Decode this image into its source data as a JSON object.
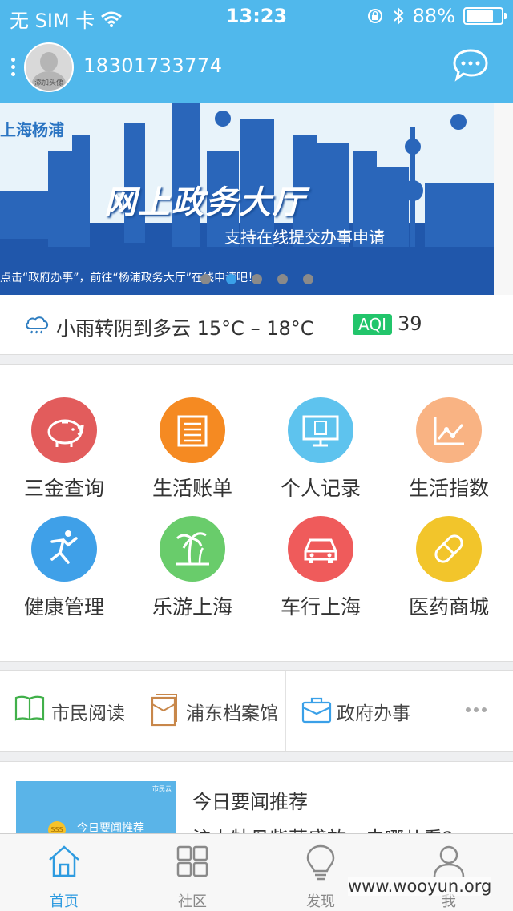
{
  "status_bar": {
    "carrier": "无 SIM 卡",
    "time": "13:23",
    "battery": "88%",
    "battery_level": 0.88
  },
  "header": {
    "avatar_caption": "添加头像",
    "phone": "18301733774",
    "icons": [
      "menu-dots-icon",
      "chat-bubble-icon"
    ]
  },
  "banner": {
    "tag": "上海杨浦",
    "title": "网上政务大厅",
    "subtitle": "支持在线提交办事申请",
    "footer": "点击“政府办事”，前往“杨浦政务大厅”在线申请吧！",
    "slide_count": 5,
    "active_slide": 2
  },
  "weather": {
    "icon": "cloud-rain-icon",
    "description": "小雨转阴到多云",
    "temp_low": "15°C",
    "dash": "–",
    "temp_high": "18°C",
    "aqi_label": "AQI",
    "aqi_value": "39"
  },
  "services": [
    {
      "label": "三金查询",
      "icon": "piggy-bank-icon",
      "color": "#e25c5c"
    },
    {
      "label": "生活账单",
      "icon": "bill-icon",
      "color": "#f58a22"
    },
    {
      "label": "个人记录",
      "icon": "monitor-record-icon",
      "color": "#5ec3ee"
    },
    {
      "label": "生活指数",
      "icon": "line-chart-icon",
      "color": "#f9b383"
    },
    {
      "label": "健康管理",
      "icon": "running-person-icon",
      "color": "#3fa0e8"
    },
    {
      "label": "乐游上海",
      "icon": "palm-tree-icon",
      "color": "#69cc6b"
    },
    {
      "label": "车行上海",
      "icon": "car-icon",
      "color": "#ef5b5b"
    },
    {
      "label": "医药商城",
      "icon": "pill-icon",
      "color": "#f2c52b"
    }
  ],
  "quick_links": [
    {
      "label": "市民阅读",
      "icon": "book-icon",
      "color": "#41b04a"
    },
    {
      "label": "浦东档案馆",
      "icon": "archive-icon",
      "color": "#c8874a"
    },
    {
      "label": "政府办事",
      "icon": "briefcase-icon",
      "color": "#3aa0e8"
    },
    {
      "label": "",
      "icon": "more-icon",
      "color": "#aaaaaa"
    }
  ],
  "news": {
    "title": "今日要闻推荐",
    "subtitle": "沪上牡丹紫藤盛放，去哪儿看?",
    "thumb_text": "今日要闻推荐",
    "thumb_coin": "SSS",
    "thumb_brand": "市民云"
  },
  "tabbar": [
    {
      "label": "首页",
      "icon": "home-icon",
      "active": true
    },
    {
      "label": "社区",
      "icon": "grid-icon",
      "active": false
    },
    {
      "label": "发现",
      "icon": "lightbulb-icon",
      "active": false
    },
    {
      "label": "我",
      "icon": "person-icon",
      "active": false
    }
  ],
  "watermark": "www.wooyun.org"
}
